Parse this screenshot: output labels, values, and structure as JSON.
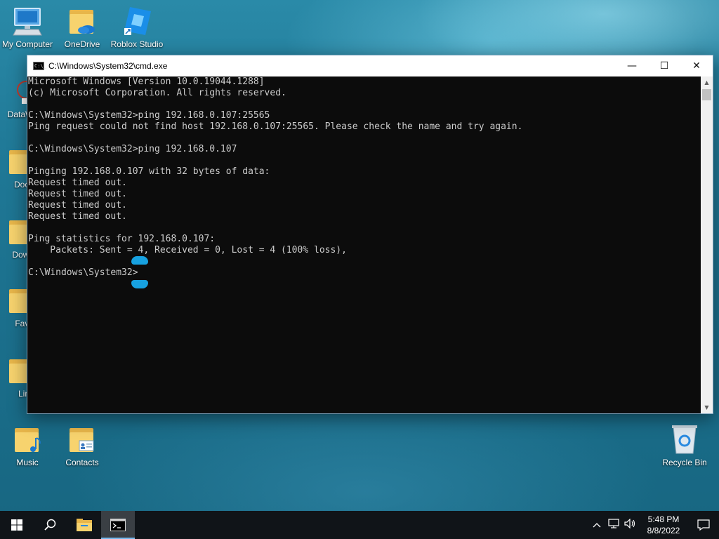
{
  "desktop": {
    "icons_top": [
      {
        "label": "My Computer",
        "icon": "computer-icon"
      },
      {
        "label": "OneDrive",
        "icon": "onedrive-folder-icon"
      },
      {
        "label": "Roblox Studio",
        "icon": "roblox-studio-icon"
      }
    ],
    "icons_left_partial": [
      {
        "label": "DataWC",
        "icon": "datawc-icon"
      },
      {
        "label": "Docu",
        "icon": "folder-icon"
      },
      {
        "label": "Down",
        "icon": "folder-icon"
      },
      {
        "label": "Favo",
        "icon": "folder-icon"
      },
      {
        "label": "Lin",
        "icon": "folder-icon"
      }
    ],
    "icons_bottom": [
      {
        "label": "Music",
        "icon": "music-folder-icon"
      },
      {
        "label": "Contacts",
        "icon": "contacts-folder-icon"
      }
    ],
    "recycle_bin": {
      "label": "Recycle Bin",
      "icon": "recycle-bin-icon"
    }
  },
  "window": {
    "title": "C:\\Windows\\System32\\cmd.exe",
    "title_icon_text": "C:\\_",
    "buttons": {
      "minimize": "—",
      "maximize": "☐",
      "close": "✕"
    },
    "console_lines": [
      "Microsoft Windows [Version 10.0.19044.1288]",
      "(c) Microsoft Corporation. All rights reserved.",
      "",
      "C:\\Windows\\System32>ping 192.168.0.107:25565",
      "Ping request could not find host 192.168.0.107:25565. Please check the name and try again.",
      "",
      "C:\\Windows\\System32>ping 192.168.0.107",
      "",
      "Pinging 192.168.0.107 with 32 bytes of data:",
      "Request timed out.",
      "Request timed out.",
      "Request timed out.",
      "Request timed out.",
      "",
      "Ping statistics for 192.168.0.107:",
      "    Packets: Sent = 4, Received = 0, Lost = 4 (100% loss),",
      "",
      "C:\\Windows\\System32>"
    ],
    "scroll_up": "▲",
    "scroll_down": "▼"
  },
  "taskbar": {
    "start_icon": "windows-logo-icon",
    "search_icon": "search-icon",
    "pinned": [
      {
        "name": "file-explorer",
        "icon": "folder-icon"
      },
      {
        "name": "cmd",
        "icon": "cmd-icon",
        "active": true
      }
    ],
    "tray": {
      "chevron": "^",
      "network": "network-icon",
      "volume": "volume-icon",
      "time": "5:48 PM",
      "date": "8/8/2022",
      "notification": "notification-icon"
    }
  },
  "colors": {
    "console_bg": "#0c0c0c",
    "console_fg": "#cccccc",
    "taskbar_bg": "#101418",
    "cursor_blob": "#17a1e0"
  }
}
